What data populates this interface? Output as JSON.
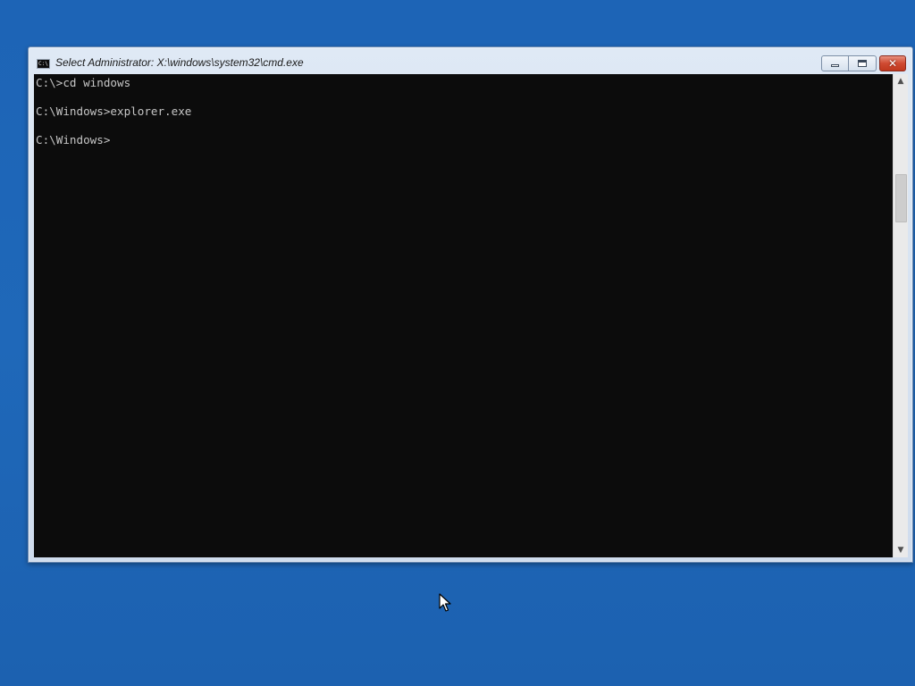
{
  "window": {
    "title": "Select Administrator: X:\\windows\\system32\\cmd.exe",
    "icon": "cmd-icon",
    "icon_text": "C:\\",
    "caption_buttons": {
      "minimize_icon": "minimize-icon",
      "maximize_icon": "restore-icon",
      "close_icon": "close-icon",
      "close_glyph": "✕",
      "close_color": "#c7432a"
    }
  },
  "console": {
    "background": "#0c0c0c",
    "foreground": "#c6c6c6",
    "lines": [
      "C:\\>cd windows",
      "",
      "C:\\Windows>explorer.exe",
      "",
      "C:\\Windows>"
    ]
  },
  "scrollbar": {
    "up_arrow": "▲",
    "down_arrow": "▼"
  },
  "desktop": {
    "background": "#1f65b5"
  }
}
